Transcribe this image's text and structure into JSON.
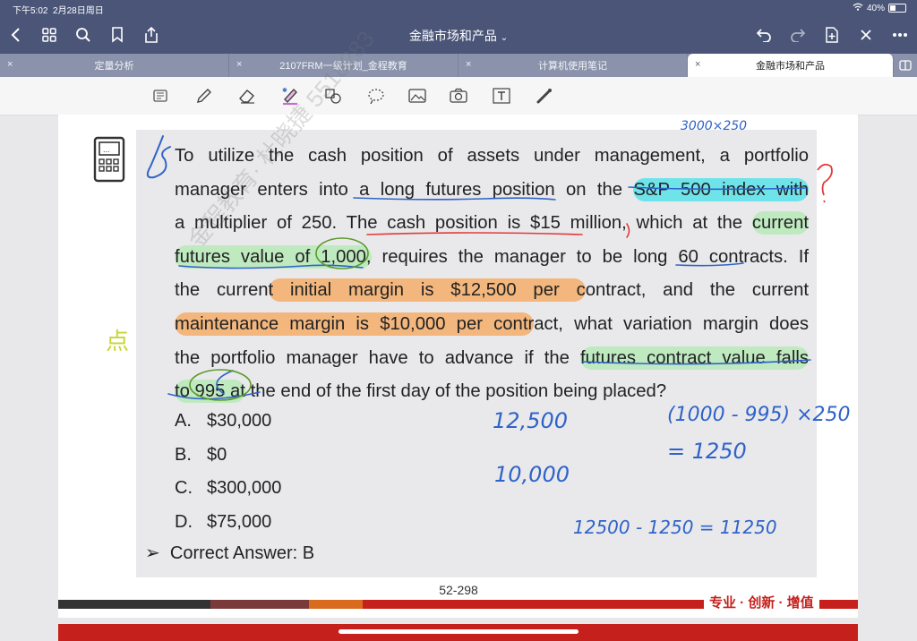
{
  "status": {
    "time": "下午5:02",
    "date": "2月28日周日",
    "battery": "40%"
  },
  "document": {
    "title": "金融市场和产品"
  },
  "tabs": [
    {
      "label": "定量分析",
      "active": false
    },
    {
      "label": "2107FRM一级计划_金程教育",
      "active": false
    },
    {
      "label": "计算机使用笔记",
      "active": false
    },
    {
      "label": "金融市场和产品",
      "active": true
    }
  ],
  "colors": {
    "nav": "#4a5578",
    "tabbar": "#8a93ab",
    "accent_red": "#c6201c",
    "pen_blue": "#2f63c9"
  },
  "palette": [
    "#55dbe8",
    "#e6b3e6",
    "#b9ecb9"
  ],
  "question": {
    "lines": [
      "To utilize the cash position of assets under management, a portfolio",
      "manager enters into a long futures position on the S&P 500 index with",
      "a multiplier of 250. The cash position is $15 million, which at the current",
      "futures value of 1,000, requires the manager to be long 60 contracts. If",
      "the current initial margin is $12,500 per contract, and the current",
      "maintenance margin is $10,000 per contract, what variation margin does",
      "the portfolio manager have to advance if the futures contract value falls",
      "to 995 at the end of the first day of the position being placed?"
    ]
  },
  "options": [
    {
      "letter": "A.",
      "text": "$30,000"
    },
    {
      "letter": "B.",
      "text": "$0"
    },
    {
      "letter": "C.",
      "text": "$300,000"
    },
    {
      "letter": "D.",
      "text": "$75,000"
    }
  ],
  "answer": "Correct Answer: B",
  "page_number": "52-298",
  "slogan": "专业 · 创新 · 增值",
  "watermark": "金程教育· 杜晓捷 5518283",
  "annotations": {
    "top": "3000×250",
    "a1": "12,500",
    "a2": "10,000",
    "b1": "(1000 - 995) ×250",
    "b2": "= 1250",
    "b3": "12500 - 1250 = 11250",
    "point": "点"
  }
}
